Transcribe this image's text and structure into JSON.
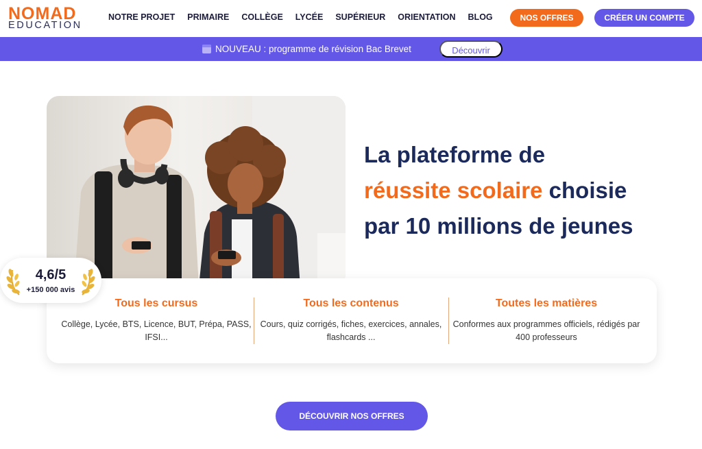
{
  "header": {
    "logo_top": "NOMAD",
    "logo_bottom": "EDUCATION",
    "nav": [
      "NOTRE PROJET",
      "PRIMAIRE",
      "COLLÈGE",
      "LYCÉE",
      "SUPÉRIEUR",
      "ORIENTATION",
      "BLOG"
    ],
    "offres_label": "NOS OFFRES",
    "compte_label": "CRÉER UN COMPTE"
  },
  "banner": {
    "text": "NOUVEAU : programme de révision Bac Brevet",
    "button_label": "Découvrir"
  },
  "hero": {
    "title_line1": "La plateforme de",
    "title_highlight": "réussite scolaire",
    "title_line2_rest": " choisie",
    "title_line3": "par 10 millions de jeunes"
  },
  "rating": {
    "score": "4,6/5",
    "count": "+150 000 avis"
  },
  "features": [
    {
      "title": "Tous les cursus",
      "text": "Collège, Lycée, BTS, Licence, BUT, Prépa, PASS, IFSI..."
    },
    {
      "title": "Tous les contenus",
      "text": "Cours, quiz corrigés, fiches, exercices, annales, flashcards ..."
    },
    {
      "title": "Toutes les matières",
      "text": "Conformes aux programmes officiels, rédigés par 400 professeurs"
    }
  ],
  "cta": {
    "label": "DÉCOUVRIR NOS OFFRES"
  },
  "colors": {
    "orange": "#f26b1d",
    "purple": "#6357e8",
    "navy": "#1b2a5b"
  }
}
